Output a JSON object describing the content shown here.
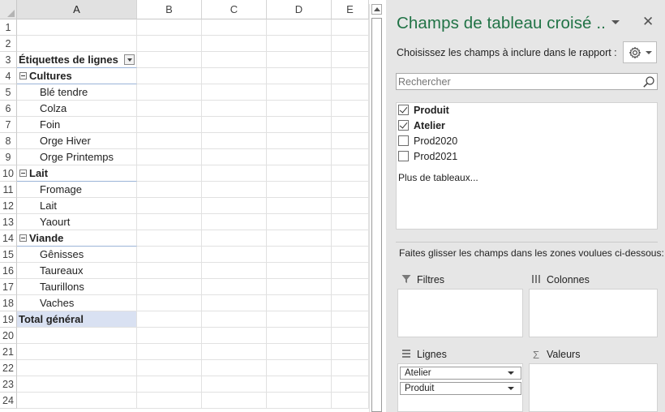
{
  "sheet": {
    "columns": [
      "A",
      "B",
      "C",
      "D",
      "E"
    ],
    "row_numbers": [
      "1",
      "2",
      "3",
      "4",
      "5",
      "6",
      "7",
      "8",
      "9",
      "10",
      "11",
      "12",
      "13",
      "14",
      "15",
      "16",
      "17",
      "18",
      "19",
      "20",
      "21",
      "22",
      "23",
      "24"
    ],
    "pivot_header": "Étiquettes de lignes",
    "groups": [
      {
        "label": "Cultures",
        "items": [
          "Blé tendre",
          "Colza",
          "Foin",
          "Orge Hiver",
          "Orge Printemps"
        ]
      },
      {
        "label": "Lait",
        "items": [
          "Fromage",
          "Lait",
          "Yaourt"
        ]
      },
      {
        "label": "Viande",
        "items": [
          "Gênisses",
          "Taureaux",
          "Taurillons",
          "Vaches"
        ]
      }
    ],
    "grand_total": "Total général"
  },
  "pane": {
    "title": "Champs de tableau croisé ..",
    "close_glyph": "✕",
    "subtitle": "Choisissez les champs à inclure dans le rapport :",
    "search_placeholder": "Rechercher",
    "fields": [
      {
        "label": "Produit",
        "checked": true
      },
      {
        "label": "Atelier",
        "checked": true
      },
      {
        "label": "Prod2020",
        "checked": false
      },
      {
        "label": "Prod2021",
        "checked": false
      }
    ],
    "more_tables": "Plus de tableaux...",
    "drag_hint": "Faites glisser les champs dans les zones voulues ci-dessous:",
    "areas": {
      "filters": "Filtres",
      "columns": "Colonnes",
      "rows": "Lignes",
      "values": "Valeurs"
    },
    "row_fields": [
      "Atelier",
      "Produit"
    ]
  }
}
